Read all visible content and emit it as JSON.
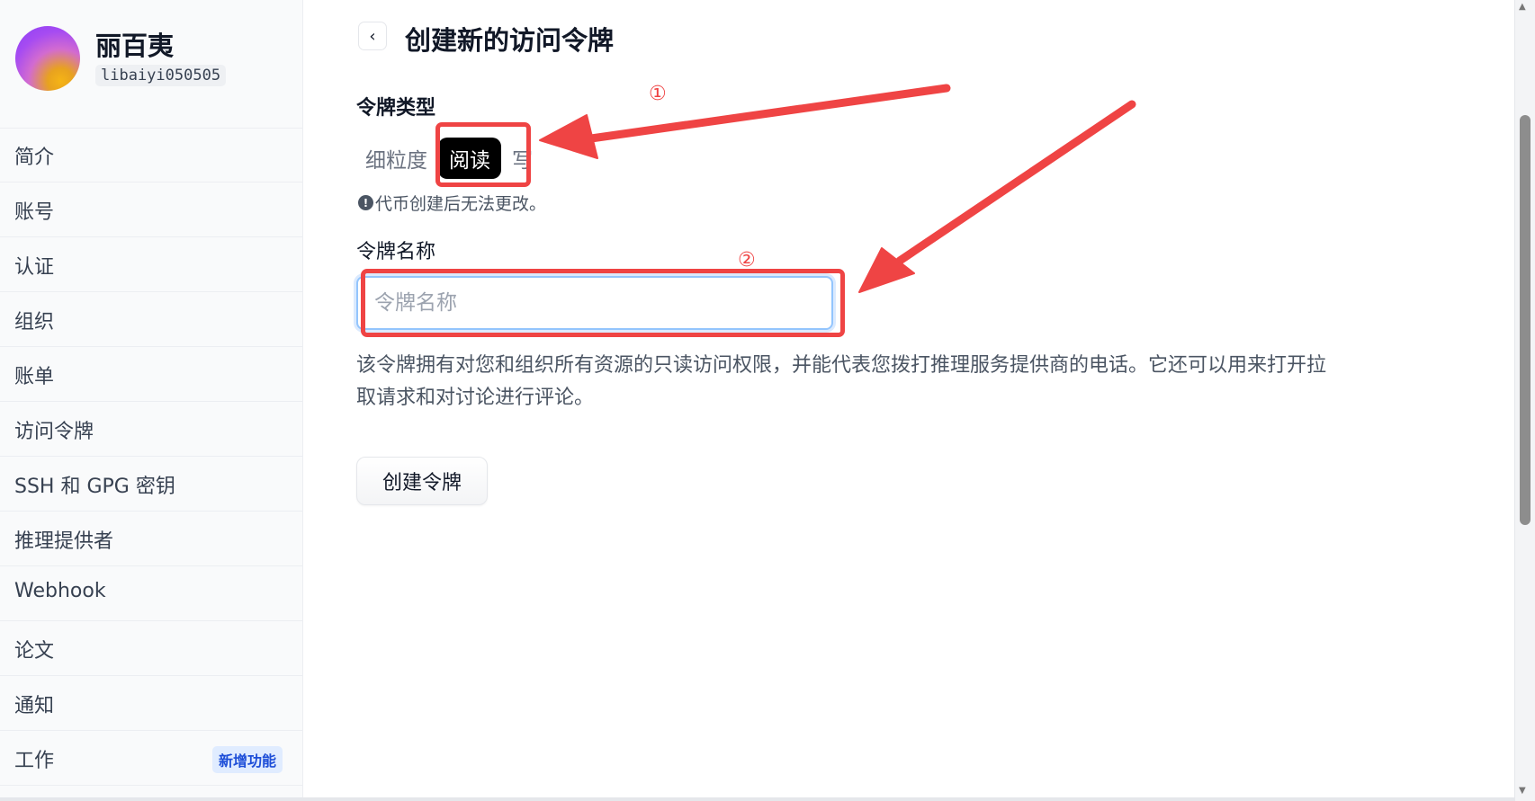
{
  "profile": {
    "name": "丽百夷",
    "username": "libaiyi050505"
  },
  "sidebar": {
    "items": [
      {
        "label": "简介"
      },
      {
        "label": "账号"
      },
      {
        "label": "认证"
      },
      {
        "label": "组织"
      },
      {
        "label": "账单"
      },
      {
        "label": "访问令牌"
      },
      {
        "label": "SSH 和 GPG 密钥"
      },
      {
        "label": "推理提供者"
      },
      {
        "label": "Webhook"
      },
      {
        "label": "论文"
      },
      {
        "label": "通知"
      },
      {
        "label": "工作",
        "badge": "新增功能"
      }
    ]
  },
  "header": {
    "back_icon": "‹",
    "title": "创建新的访问令牌"
  },
  "token_type": {
    "label": "令牌类型",
    "options": [
      "细粒度",
      "阅读",
      "写"
    ],
    "selected": "阅读",
    "note": "代币创建后无法更改。",
    "note_icon": "!"
  },
  "token_name": {
    "label": "令牌名称",
    "placeholder": "令牌名称",
    "value": ""
  },
  "description": "该令牌拥有对您和组织所有资源的只读访问权限，并能代表您拨打推理服务提供商的电话。它还可以用来打开拉取请求和对讨论进行评论。",
  "create_button": "创建令牌",
  "annotations": {
    "marker_1": "①",
    "marker_2": "②",
    "color": "#ef4444"
  },
  "scrollbar": {
    "up": "▲",
    "down": "▼"
  }
}
